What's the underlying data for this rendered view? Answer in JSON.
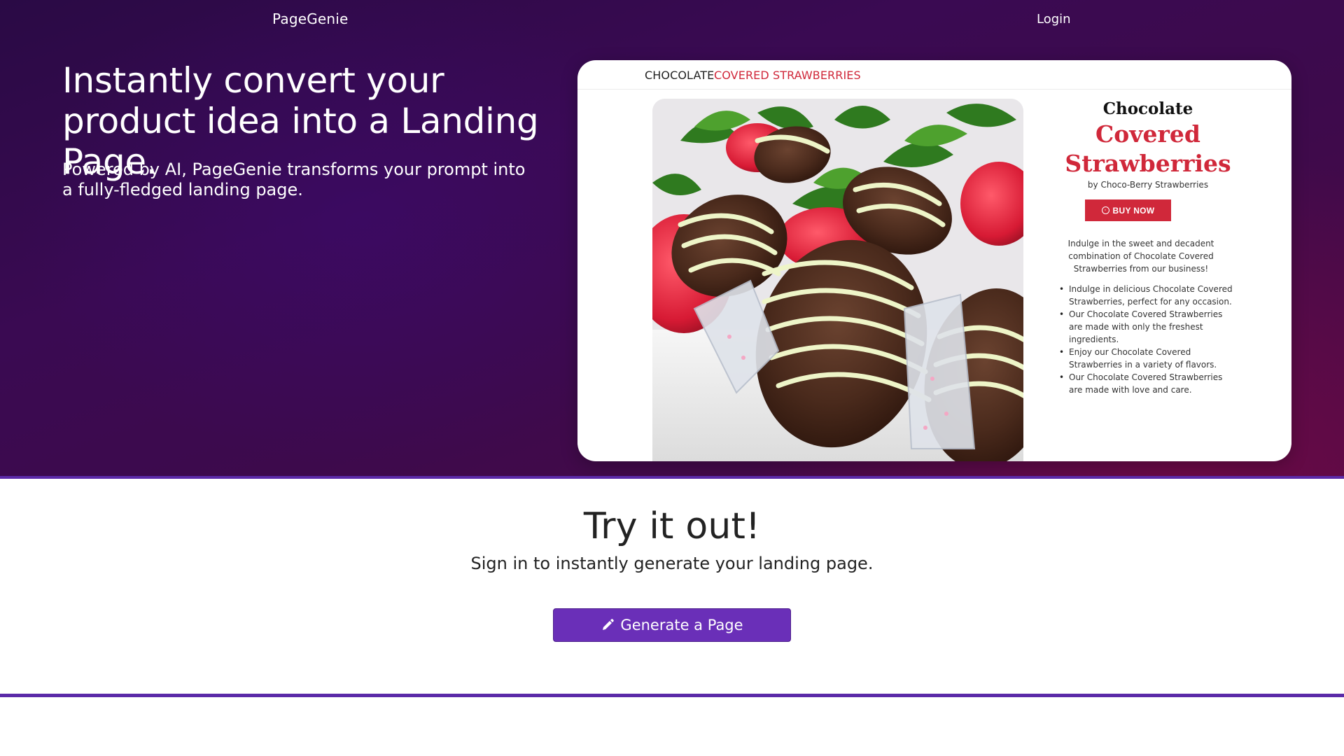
{
  "nav": {
    "brand": "PageGenie",
    "login": "Login"
  },
  "hero": {
    "headline": "Instantly convert your product idea into a Landing Page.",
    "subheadline": "Powered by AI, PageGenie transforms your prompt into a fully-fledged landing page."
  },
  "preview": {
    "header_title_part1": "CHOCOLATE",
    "header_title_part2": "COVERED STRAWBERRIES",
    "product_title_line1": "Chocolate",
    "product_title_line2": "Covered",
    "product_title_line3": "Strawberries",
    "byline": "by Choco-Berry Strawberries",
    "buy_button": "BUY NOW",
    "intro": "Indulge in the sweet and decadent combination of Chocolate Covered Strawberries from our business!",
    "bullets": [
      "Indulge in delicious Chocolate Covered Strawberries, perfect for any occasion.",
      "Our Chocolate Covered Strawberries are made with only the freshest ingredients.",
      "Enjoy our Chocolate Covered Strawberries in a variety of flavors.",
      "Our Chocolate Covered Strawberries are made with love and care."
    ],
    "image_icon": "strawberries-photo"
  },
  "try_section": {
    "title": "Try it out!",
    "subtitle": "Sign in to instantly generate your landing page.",
    "button_label": "Generate a Page",
    "button_icon": "pencil-icon"
  },
  "colors": {
    "hero_bg": "#3a0a52",
    "accent_purple": "#6a2fb8",
    "section_border": "#5b2aa8",
    "preview_red": "#d0283a"
  }
}
